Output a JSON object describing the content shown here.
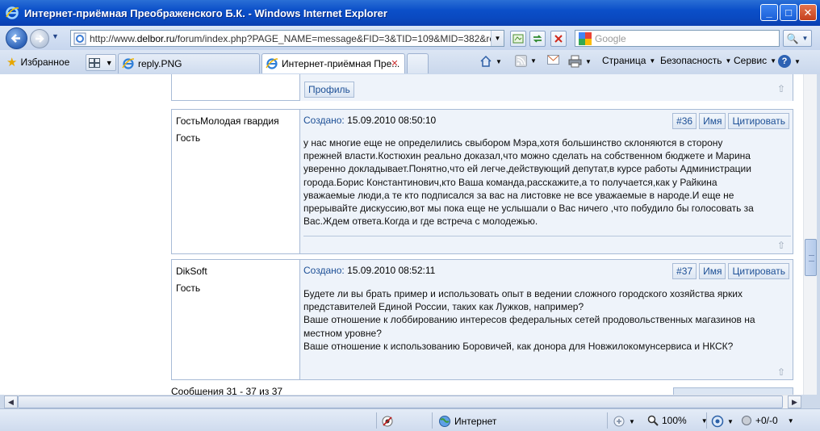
{
  "window": {
    "title": "Интернет-приёмная Преображенского Б.К. - Windows Internet Explorer",
    "btn_min": "_",
    "btn_max": "□",
    "btn_close": "✕"
  },
  "address": {
    "url_prefix": "http://www.",
    "url_domain": "delbor.ru",
    "url_rest": "/forum/index.php?PAGE_NAME=message&FID=3&TID=109&MID=382&result=re"
  },
  "search": {
    "placeholder": "Google",
    "go_label": "🔍"
  },
  "favorites_label": "Избранное",
  "tabs": [
    {
      "label": "reply.PNG",
      "active": false
    },
    {
      "label": "Интернет-приёмная Пре...",
      "active": true,
      "close": "✕"
    }
  ],
  "commands": {
    "page": "Страница",
    "safety": "Безопасность",
    "tools": "Сервис",
    "help": "?"
  },
  "forum": {
    "profile_label": "Профиль",
    "name_label": "Имя",
    "quote_label": "Цитировать",
    "created_label": "Создано:",
    "posts": [
      {
        "author": "ГостьМолодая гвардия",
        "role": "Гость",
        "created": "15.09.2010 08:50:10",
        "number": "#36",
        "lines": [
          "у нас многие еще не определились свыбором Мэра,хотя большинство склоняются в сторону",
          "прежней власти.Костюхин реально доказал,что можно сделать на собственном бюджете и Марина",
          "уверенно докладывает.Понятно,что ей легче,действующий депутат,в курсе работы Администрации",
          "города.Борис Константинович,кто Ваша команда,расскажите,а то получается,как у Райкина",
          "уважаемые люди,а те кто подписался за вас на листовке не все уважаемые в народе.И еще не",
          "прерывайте дискуссию,вот мы пока еще не услышали о Вас ничего ,что побудило бы голосовать за",
          "Вас.Ждем ответа.Когда и где встреча с молодежью."
        ]
      },
      {
        "author": "DikSoft",
        "role": "Гость",
        "created": "15.09.2010 08:52:11",
        "number": "#37",
        "lines": [
          "Будете ли вы брать пример и использовать опыт в ведении сложного городского хозяйства ярких",
          "представителей Единой России, таких как Лужков, например?",
          "Ваше отношение к лоббированию интересов федеральных сетей продовольственных магазинов на",
          "местном уровне?",
          "Ваше отношение к использованию Боровичей, как донора для Новжилокомунсервиса и НКСК?"
        ]
      }
    ],
    "footer": "Сообщения 31 - 37 из 37"
  },
  "status": {
    "zone": "Интернет",
    "zoom": "100%",
    "extra": "+0/-0"
  },
  "icons": {
    "back": "back-arrow-icon",
    "forward": "forward-arrow-icon",
    "favorites": "star-icon",
    "home": "home-icon",
    "feeds": "rss-icon",
    "print": "printer-icon"
  }
}
